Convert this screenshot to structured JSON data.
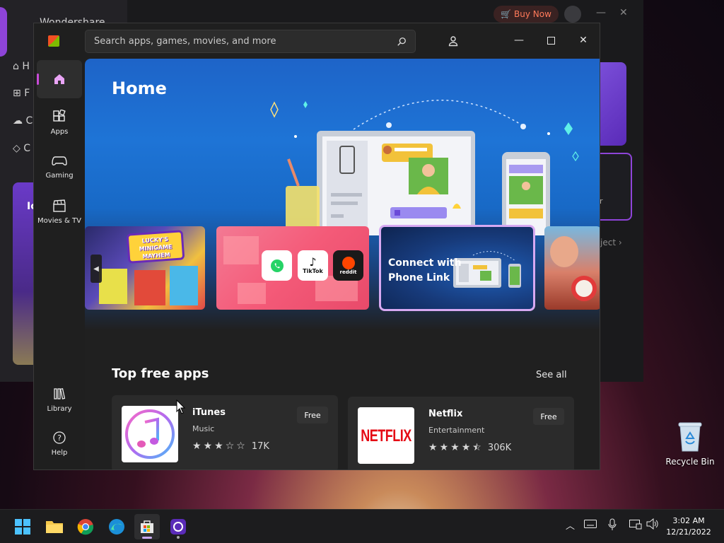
{
  "background_app": {
    "title": "Wondershare",
    "buy_label": "Buy Now",
    "nav_letters": [
      "H",
      "F",
      "C",
      "C"
    ],
    "card_letter": "Ic",
    "card_text": "r",
    "select_text": "ject"
  },
  "store": {
    "search_placeholder": "Search apps, games, movies, and more",
    "nav": {
      "apps": "Apps",
      "gaming": "Gaming",
      "movies": "Movies & TV",
      "library": "Library",
      "help": "Help"
    },
    "hero_title": "Home",
    "carousel": {
      "game_title_lines": [
        "LUCKY'S",
        "MINIGAME",
        "MAYHEM"
      ],
      "social_labels": [
        "TikTok",
        "reddit"
      ],
      "phone_link_text": "Connect with Phone Link"
    },
    "section_title": "Top free apps",
    "see_all": "See all",
    "apps": [
      {
        "name": "iTunes",
        "category": "Music",
        "price": "Free",
        "rating": 3,
        "reviews": "17K"
      },
      {
        "name": "Netflix",
        "category": "Entertainment",
        "price": "Free",
        "rating": 4.5,
        "reviews": "306K",
        "logo_text": "NETFLIX"
      }
    ]
  },
  "desktop": {
    "recycle_bin": "Recycle Bin"
  },
  "taskbar": {
    "time": "3:02 AM",
    "date": "12/21/2022"
  },
  "colors": {
    "accent": "#c84bd8",
    "netflix_red": "#e50914",
    "store_bg": "#202020",
    "phone_link_border": "#d7a9f2"
  }
}
